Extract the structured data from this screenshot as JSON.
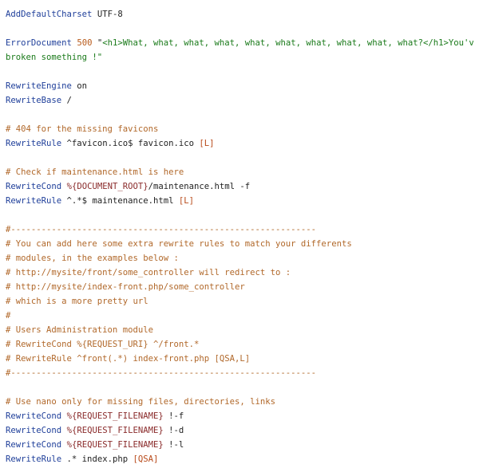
{
  "lines": [
    {
      "tokens": [
        {
          "t": "AddDefaultCharset",
          "c": "kw"
        },
        {
          "t": " UTF-8",
          "c": "plain"
        }
      ]
    },
    {
      "tokens": []
    },
    {
      "tokens": [
        {
          "t": "ErrorDocument",
          "c": "kw"
        },
        {
          "t": " ",
          "c": "plain"
        },
        {
          "t": "500",
          "c": "num"
        },
        {
          "t": " \"",
          "c": "plain"
        },
        {
          "t": "<h1>What, what, what, what, what, what, what, what, what, what?</h1>You've",
          "c": "str"
        }
      ]
    },
    {
      "tokens": [
        {
          "t": "broken something !\"",
          "c": "str"
        }
      ]
    },
    {
      "tokens": []
    },
    {
      "tokens": [
        {
          "t": "RewriteEngine",
          "c": "kw"
        },
        {
          "t": " on",
          "c": "plain"
        }
      ]
    },
    {
      "tokens": [
        {
          "t": "RewriteBase",
          "c": "kw"
        },
        {
          "t": " /",
          "c": "plain"
        }
      ]
    },
    {
      "tokens": []
    },
    {
      "tokens": [
        {
          "t": "# 404 for the missing favicons",
          "c": "comment"
        }
      ]
    },
    {
      "tokens": [
        {
          "t": "RewriteRule",
          "c": "kw"
        },
        {
          "t": " ^favicon.ico$ favicon.ico ",
          "c": "plain"
        },
        {
          "t": "[L]",
          "c": "flag"
        }
      ]
    },
    {
      "tokens": []
    },
    {
      "tokens": [
        {
          "t": "# Check if maintenance.html is here",
          "c": "comment"
        }
      ]
    },
    {
      "tokens": [
        {
          "t": "RewriteCond",
          "c": "kw"
        },
        {
          "t": " ",
          "c": "plain"
        },
        {
          "t": "%{DOCUMENT_ROOT}",
          "c": "var"
        },
        {
          "t": "/maintenance.html -f",
          "c": "plain"
        }
      ]
    },
    {
      "tokens": [
        {
          "t": "RewriteRule",
          "c": "kw"
        },
        {
          "t": " ^.*$ maintenance.html ",
          "c": "plain"
        },
        {
          "t": "[L]",
          "c": "flag"
        }
      ]
    },
    {
      "tokens": []
    },
    {
      "tokens": [
        {
          "t": "#------------------------------------------------------------",
          "c": "comment"
        }
      ]
    },
    {
      "tokens": [
        {
          "t": "# You can add here some extra rewrite rules to match your differents",
          "c": "comment"
        }
      ]
    },
    {
      "tokens": [
        {
          "t": "# modules, in the examples below :",
          "c": "comment"
        }
      ]
    },
    {
      "tokens": [
        {
          "t": "# http://mysite/front/some_controller will redirect to :",
          "c": "comment"
        }
      ]
    },
    {
      "tokens": [
        {
          "t": "# http://mysite/index-front.php/some_controller",
          "c": "comment"
        }
      ]
    },
    {
      "tokens": [
        {
          "t": "# which is a more pretty url",
          "c": "comment"
        }
      ]
    },
    {
      "tokens": [
        {
          "t": "#",
          "c": "comment"
        }
      ]
    },
    {
      "tokens": [
        {
          "t": "# Users Administration module",
          "c": "comment"
        }
      ]
    },
    {
      "tokens": [
        {
          "t": "# RewriteCond %{REQUEST_URI} ^/front.*",
          "c": "comment"
        }
      ]
    },
    {
      "tokens": [
        {
          "t": "# RewriteRule ^front(.*) index-front.php [QSA,L]",
          "c": "comment"
        }
      ]
    },
    {
      "tokens": [
        {
          "t": "#------------------------------------------------------------",
          "c": "comment"
        }
      ]
    },
    {
      "tokens": []
    },
    {
      "tokens": [
        {
          "t": "# Use nano only for missing files, directories, links",
          "c": "comment"
        }
      ]
    },
    {
      "tokens": [
        {
          "t": "RewriteCond",
          "c": "kw"
        },
        {
          "t": " ",
          "c": "plain"
        },
        {
          "t": "%{REQUEST_FILENAME}",
          "c": "var"
        },
        {
          "t": " !-f",
          "c": "plain"
        }
      ]
    },
    {
      "tokens": [
        {
          "t": "RewriteCond",
          "c": "kw"
        },
        {
          "t": " ",
          "c": "plain"
        },
        {
          "t": "%{REQUEST_FILENAME}",
          "c": "var"
        },
        {
          "t": " !-d",
          "c": "plain"
        }
      ]
    },
    {
      "tokens": [
        {
          "t": "RewriteCond",
          "c": "kw"
        },
        {
          "t": " ",
          "c": "plain"
        },
        {
          "t": "%{REQUEST_FILENAME}",
          "c": "var"
        },
        {
          "t": " !-l",
          "c": "plain"
        }
      ]
    },
    {
      "tokens": [
        {
          "t": "RewriteRule",
          "c": "kw"
        },
        {
          "t": " .* index.php ",
          "c": "plain"
        },
        {
          "t": "[QSA]",
          "c": "flag"
        }
      ]
    }
  ]
}
